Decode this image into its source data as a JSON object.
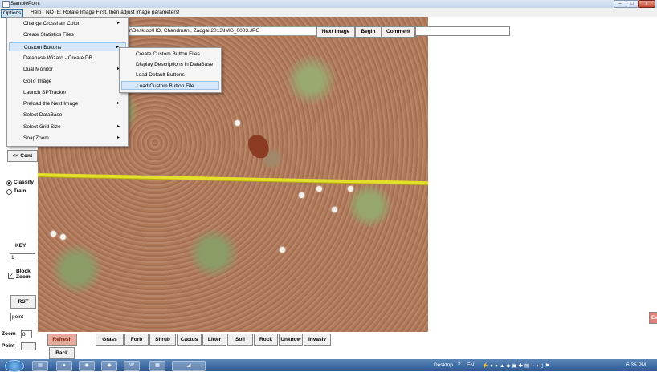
{
  "window": {
    "title": "SamplePoint",
    "controls": {
      "minimize": "–",
      "maximize": "□",
      "close": "x"
    }
  },
  "menubar": {
    "options": "Options",
    "help": "Help",
    "note": "NOTE: Rotate Image First, then adjust image parameters!"
  },
  "toolbar": {
    "path": "ser\\Desktop\\HO, Chandmani, Zadgai 2013\\IMG_0003.JPG",
    "next_image": "Next Image",
    "begin": "Begin",
    "comment": "Comment",
    "comment_value": ""
  },
  "options_menu": [
    {
      "label": "Change Crosshair Color",
      "submenu": true
    },
    {
      "label": "Create Statistics Files",
      "submenu": false
    },
    {
      "label": "Custom Buttons",
      "submenu": true
    },
    {
      "label": "Database Wizard - Create DB",
      "submenu": false
    },
    {
      "label": "Dual Monitor",
      "submenu": true
    },
    {
      "label": "GoTo Image",
      "submenu": false
    },
    {
      "label": "Launch SPTracker",
      "submenu": false
    },
    {
      "label": "Preload the Next Image",
      "submenu": true
    },
    {
      "label": "Select DataBase",
      "submenu": false
    },
    {
      "label": "Select Grid Size",
      "submenu": true
    },
    {
      "label": "SnapZoom",
      "submenu": true
    }
  ],
  "submenu_arrow": "▸",
  "custom_buttons_submenu": [
    "Create Custom Button Files",
    "Display Descriptions in DataBase",
    "Load Default Buttons",
    "Load Custom Button File"
  ],
  "left_panel": {
    "cont_button": "<< Cont",
    "mode_classify": "Classify",
    "mode_train": "Train",
    "key_label": "KEY",
    "key_value": "1",
    "block_zoom": "Block Zoom",
    "rst_button": "RST",
    "point_field": "point"
  },
  "bottom": {
    "zoom_label": "Zoom",
    "zoom_value": "8",
    "point_label": "Point",
    "point_value": "",
    "refresh": "Refresh",
    "back": "Back",
    "categories": [
      "Grass",
      "Forb",
      "Shrub",
      "Cactus",
      "Litter",
      "Soil",
      "Rock",
      "Unknow",
      "Invasiv"
    ]
  },
  "right_edge_button": "Ex",
  "taskbar": {
    "desktop": "Desktop",
    "overflow": "»",
    "lang": "EN",
    "time": "6:35 PM"
  }
}
